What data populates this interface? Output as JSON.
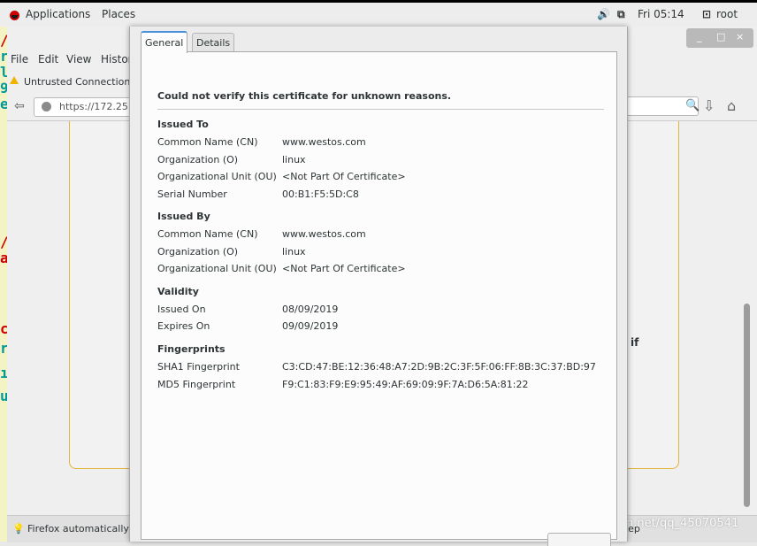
{
  "topbar": {
    "applications": "Applications",
    "places": "Places",
    "clock": "Fri 05:14",
    "user": "root",
    "volume_icon": "speaker-icon",
    "network_icon": "network-icon",
    "user_icon": "user-icon"
  },
  "firefox": {
    "menu": {
      "file": "File",
      "edit": "Edit",
      "view": "View",
      "history": "Histor"
    },
    "tab_title": "Untrusted Connection",
    "url": "https://172.25",
    "error_text_fragment": "if",
    "status_text": "Firefox automatically",
    "status_right": "Rep",
    "window_buttons": {
      "minimize": "_",
      "maximize": "□",
      "close": "×"
    }
  },
  "watermark": "https://blog.csdn.net/qq_45070541",
  "dialog": {
    "tabs": [
      {
        "label": "General"
      },
      {
        "label": "Details"
      }
    ],
    "warning": "Could not verify this certificate for unknown reasons.",
    "issued_to": {
      "title": "Issued To",
      "rows": [
        {
          "label": "Common Name (CN)",
          "value": "www.westos.com"
        },
        {
          "label": "Organization (O)",
          "value": "linux"
        },
        {
          "label": "Organizational Unit (OU)",
          "value": "<Not Part Of Certificate>"
        },
        {
          "label": "Serial Number",
          "value": "00:B1:F5:5D:C8"
        }
      ]
    },
    "issued_by": {
      "title": "Issued By",
      "rows": [
        {
          "label": "Common Name (CN)",
          "value": "www.westos.com"
        },
        {
          "label": "Organization (O)",
          "value": "linux"
        },
        {
          "label": "Organizational Unit (OU)",
          "value": "<Not Part Of Certificate>"
        }
      ]
    },
    "validity": {
      "title": "Validity",
      "rows": [
        {
          "label": "Issued On",
          "value": "08/09/2019"
        },
        {
          "label": "Expires On",
          "value": "09/09/2019"
        }
      ]
    },
    "fingerprints": {
      "title": "Fingerprints",
      "rows": [
        {
          "label": "SHA1 Fingerprint",
          "value": "C3:CD:47:BE:12:36:48:A7:2D:9B:2C:3F:5F:06:FF:8B:3C:37:BD:97"
        },
        {
          "label": "MD5 Fingerprint",
          "value": "F9:C1:83:F9:E9:95:49:AF:69:09:9F:7A:D6:5A:81:22"
        }
      ]
    }
  }
}
